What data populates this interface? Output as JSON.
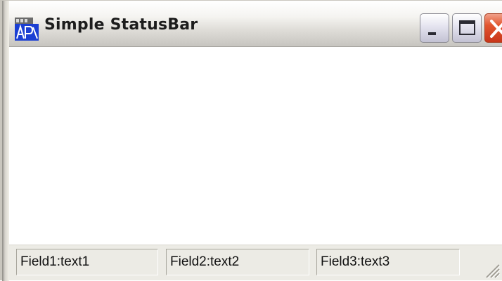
{
  "window": {
    "title": "Simple StatusBar",
    "app_icon": "java-app-icon",
    "controls": {
      "minimize": "minimize-icon",
      "maximize": "maximize-icon",
      "close": "close-icon"
    }
  },
  "status_bar": {
    "fields": [
      {
        "text": "Field1:text1"
      },
      {
        "text": "Field2:text2"
      },
      {
        "text": "Field3:text3"
      }
    ]
  },
  "colors": {
    "title_text": "#1c1c1c",
    "close_button": "#e2562e",
    "status_bar_bg": "#ecebe5",
    "client_bg": "#ffffff"
  }
}
